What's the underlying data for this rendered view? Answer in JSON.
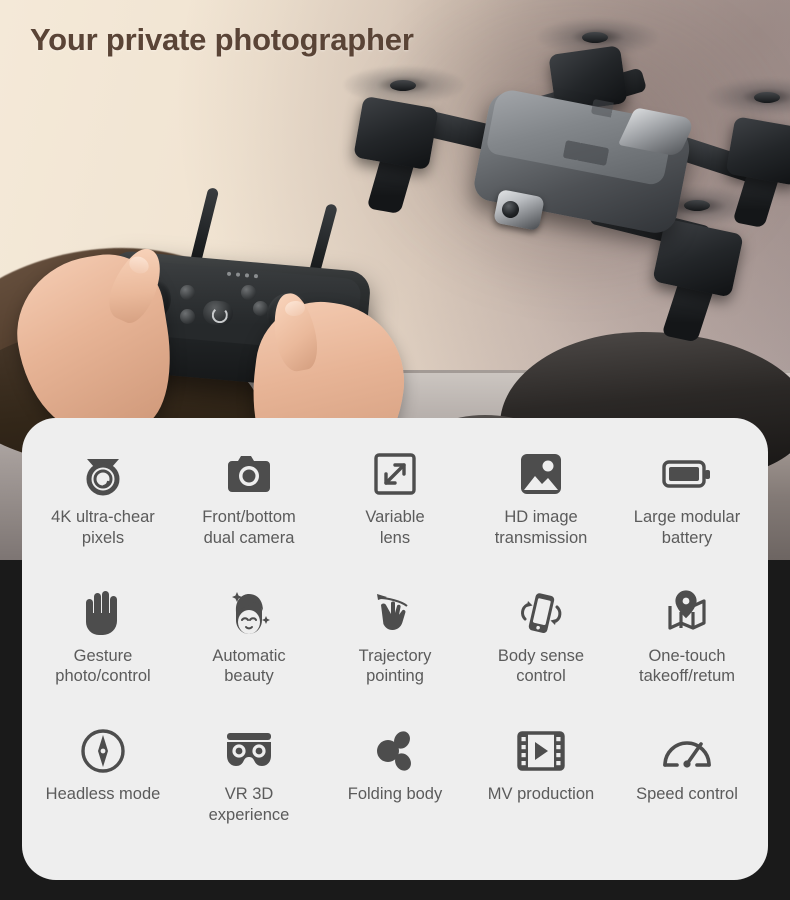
{
  "headline": "Your private photographer",
  "colors": {
    "page_background": "#1a1a1a",
    "card_background": "#eeeeee",
    "headline_text": "#5a4436",
    "label_text": "#5b5b5b",
    "icon_fill": "#4d4d4d",
    "sky": "#f2e6d5"
  },
  "photo": {
    "scene_description": "Drone flying over rocky coastal seascape with hands holding a remote control",
    "drone": {
      "name": "folding-quadcopter-drone",
      "propeller_count": 4
    },
    "remote": {
      "name": "drone-remote-control",
      "antenna_count": 2,
      "joystick_count": 2,
      "led_count": 4
    }
  },
  "features": [
    [
      {
        "icon": "dome-camera-icon",
        "label": "4K ultra-chear\npixels"
      },
      {
        "icon": "photo-camera-icon",
        "label": "Front/bottom\ndual camera"
      },
      {
        "icon": "resize-arrows-icon",
        "label": "Variable\nlens"
      },
      {
        "icon": "image-picture-icon",
        "label": "HD image\ntransmission"
      },
      {
        "icon": "battery-icon",
        "label": "Large modular\nbattery"
      }
    ],
    [
      {
        "icon": "hand-palm-icon",
        "label": "Gesture\nphoto/control"
      },
      {
        "icon": "beauty-face-icon",
        "label": "Automatic\nbeauty"
      },
      {
        "icon": "swipe-hand-icon",
        "label": "Trajectory\npointing"
      },
      {
        "icon": "tilt-phone-icon",
        "label": "Body sense\ncontrol"
      },
      {
        "icon": "map-pin-icon",
        "label": "One-touch\ntakeoff/retum"
      }
    ],
    [
      {
        "icon": "compass-icon",
        "label": "Headless mode"
      },
      {
        "icon": "vr-goggles-icon",
        "label": "VR 3D\nexperience"
      },
      {
        "icon": "folding-body-icon",
        "label": "Folding body"
      },
      {
        "icon": "film-play-icon",
        "label": "MV production"
      },
      {
        "icon": "speedometer-icon",
        "label": "Speed control"
      }
    ]
  ]
}
